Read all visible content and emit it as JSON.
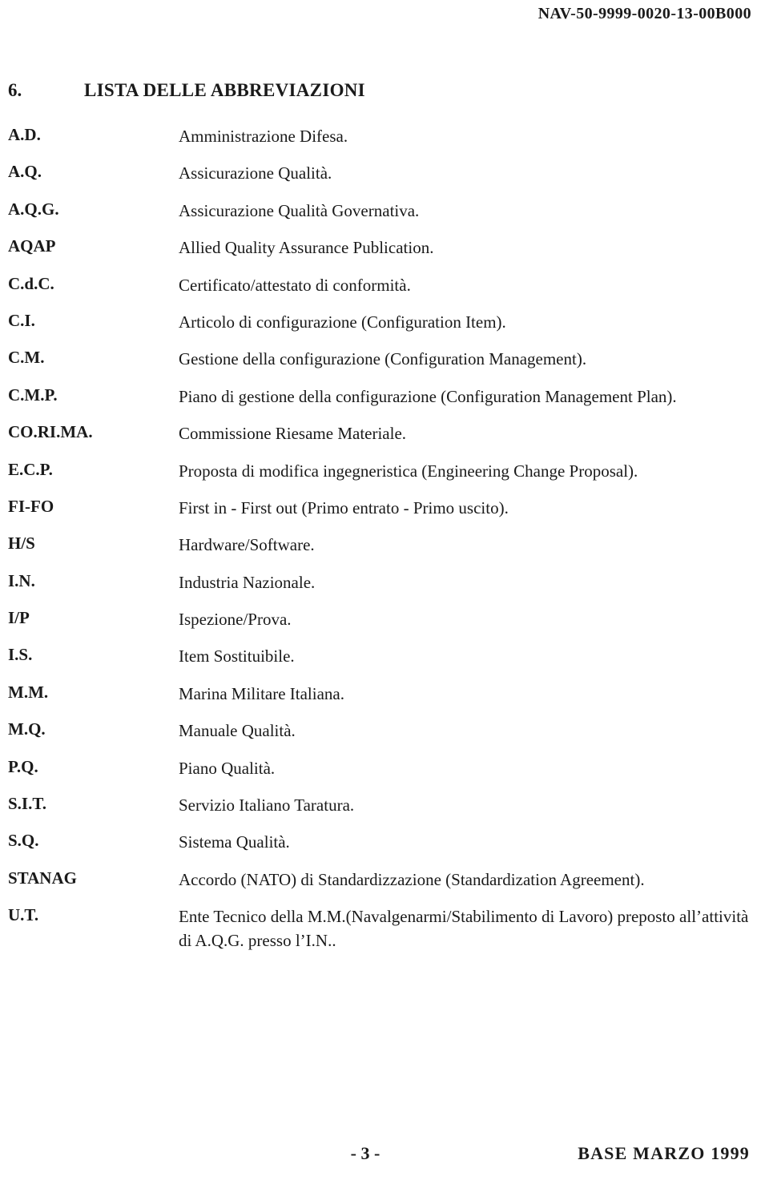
{
  "header": {
    "document_code": "NAV-50-9999-0020-13-00B000"
  },
  "section": {
    "number": "6.",
    "title": "LISTA DELLE ABBREVIAZIONI"
  },
  "abbreviations": [
    {
      "term": "A.D.",
      "definition": "Amministrazione Difesa."
    },
    {
      "term": "A.Q.",
      "definition": "Assicurazione Qualità."
    },
    {
      "term": "A.Q.G.",
      "definition": "Assicurazione Qualità Governativa."
    },
    {
      "term": "AQAP",
      "definition": "Allied Quality Assurance Publication."
    },
    {
      "term": "C.d.C.",
      "definition": "Certificato/attestato di conformità."
    },
    {
      "term": "C.I.",
      "definition": "Articolo di configurazione (Configuration Item)."
    },
    {
      "term": "C.M.",
      "definition": "Gestione della configurazione (Configuration Management)."
    },
    {
      "term": "C.M.P.",
      "definition": "Piano di gestione della configurazione (Configuration Management Plan)."
    },
    {
      "term": "CO.RI.MA.",
      "definition": "Commissione Riesame Materiale."
    },
    {
      "term": "E.C.P.",
      "definition": "Proposta di modifica ingegneristica (Engineering Change Proposal)."
    },
    {
      "term": "FI-FO",
      "definition": "First in - First out (Primo entrato - Primo uscito)."
    },
    {
      "term": "H/S",
      "definition": "Hardware/Software."
    },
    {
      "term": "I.N.",
      "definition": "Industria Nazionale."
    },
    {
      "term": "I/P",
      "definition": "Ispezione/Prova."
    },
    {
      "term": "I.S.",
      "definition": "Item Sostituibile."
    },
    {
      "term": "M.M.",
      "definition": "Marina Militare Italiana."
    },
    {
      "term": "M.Q.",
      "definition": "Manuale Qualità."
    },
    {
      "term": "P.Q.",
      "definition": "Piano Qualità."
    },
    {
      "term": "S.I.T.",
      "definition": "Servizio Italiano Taratura."
    },
    {
      "term": "S.Q.",
      "definition": "Sistema Qualità."
    },
    {
      "term": "STANAG",
      "definition": "Accordo (NATO) di Standardizzazione (Standardization Agreement)."
    },
    {
      "term": "U.T.",
      "definition": "Ente Tecnico della M.M.(Navalgenarmi/Stabilimento di Lavoro) preposto all’attività di A.Q.G. presso l’I.N.."
    }
  ],
  "footer": {
    "page_number": "- 3 -",
    "edition": "BASE  MARZO  1999"
  }
}
